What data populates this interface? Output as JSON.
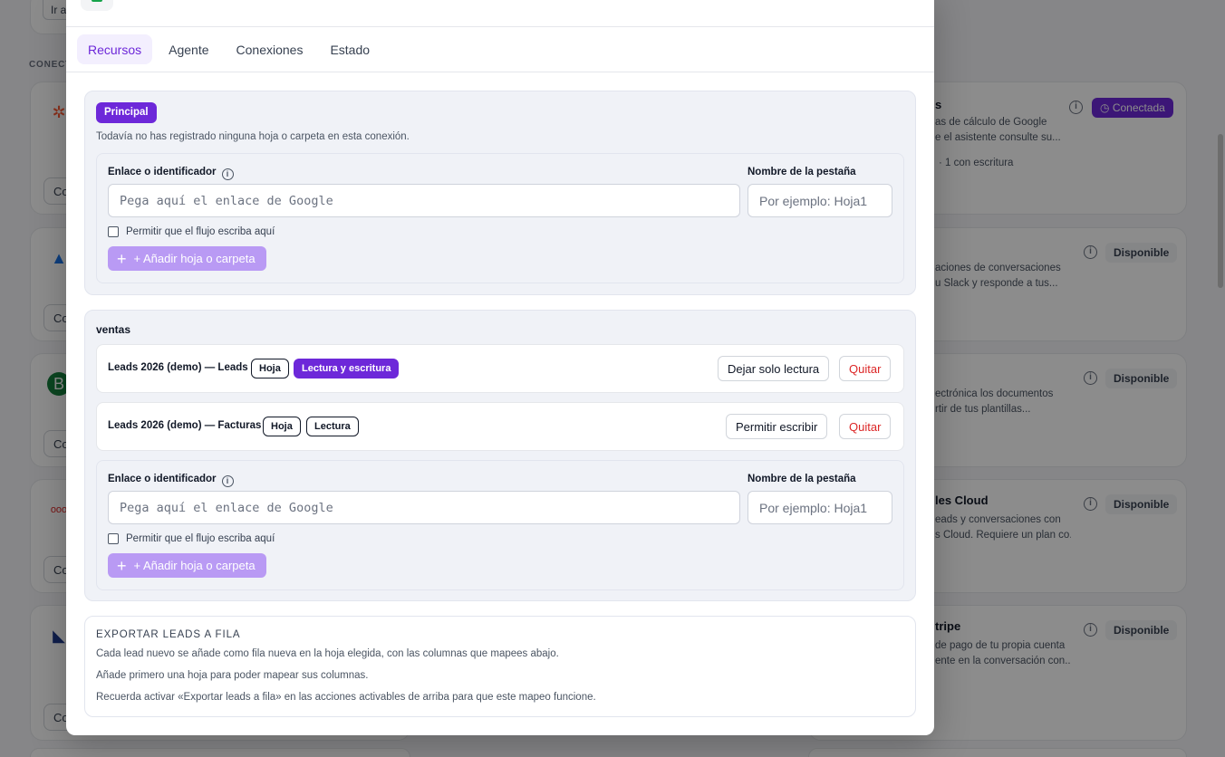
{
  "background": {
    "top_button_label": "Ir a",
    "section_label": "CONECT",
    "left_button_label": "Co",
    "right_cards": [
      {
        "title": "s",
        "desc1": "as de cálculo de Google",
        "desc2": "e el asistente consulte su...",
        "meta": "· 1 con escritura",
        "badge": "Conectada"
      },
      {
        "title": "",
        "desc1": "aciones de conversaciones",
        "desc2": "u Slack y responde a tus...",
        "meta": "",
        "badge": "Disponible"
      },
      {
        "title": "",
        "desc1": "ectrónica los documentos",
        "desc2": "rtir de tus plantillas...",
        "meta": "",
        "badge": "Disponible"
      },
      {
        "title": "les Cloud",
        "desc1": "eads y conversaciones con",
        "desc2": "s Cloud. Requiere un plan co...",
        "meta": "",
        "badge": "Disponible"
      },
      {
        "title": "tripe",
        "desc1": "de pago de tu propia cuenta",
        "desc2": "ente en la conversación con...",
        "meta": "",
        "badge": "Disponible"
      }
    ]
  },
  "modal": {
    "tabs": [
      {
        "label": "Recursos",
        "active": true
      },
      {
        "label": "Agente",
        "active": false
      },
      {
        "label": "Conexiones",
        "active": false
      },
      {
        "label": "Estado",
        "active": false
      }
    ],
    "principal": {
      "badge": "Principal",
      "empty_note": "Todavía no has registrado ninguna hoja o carpeta en esta conexión.",
      "form": {
        "link_label": "Enlace o identificador",
        "link_placeholder": "Pega aquí el enlace de Google",
        "tab_label": "Nombre de la pestaña",
        "tab_placeholder": "Por ejemplo: Hoja1",
        "write_checkbox_label": "Permitir que el flujo escriba aquí",
        "write_checked": false,
        "add_button": "+ Añadir hoja o carpeta"
      }
    },
    "ventas": {
      "title": "ventas",
      "rows": [
        {
          "name": "Leads 2026 (demo) — Leads",
          "type_tag": "Hoja",
          "access_tag": "Lectura y escritura",
          "toggle_button": "Dejar solo lectura",
          "remove_button": "Quitar"
        },
        {
          "name": "Leads 2026 (demo) — Facturas",
          "type_tag": "Hoja",
          "access_tag": "Lectura",
          "toggle_button": "Permitir escribir",
          "remove_button": "Quitar"
        }
      ],
      "form": {
        "link_label": "Enlace o identificador",
        "link_placeholder": "Pega aquí el enlace de Google",
        "tab_label": "Nombre de la pestaña",
        "tab_placeholder": "Por ejemplo: Hoja1",
        "write_checkbox_label": "Permitir que el flujo escriba aquí",
        "write_checked": false,
        "add_button": "+ Añadir hoja o carpeta"
      }
    },
    "export": {
      "title": "EXPORTAR LEADS A FILA",
      "line1": "Cada lead nuevo se añade como fila nueva en la hoja elegida, con las columnas que mapees abajo.",
      "line2": "Añade primero una hoja para poder mapear sus columnas.",
      "line3": "Recuerda activar «Exportar leads a fila» en las acciones activables de arriba para que este mapeo funcione."
    }
  }
}
